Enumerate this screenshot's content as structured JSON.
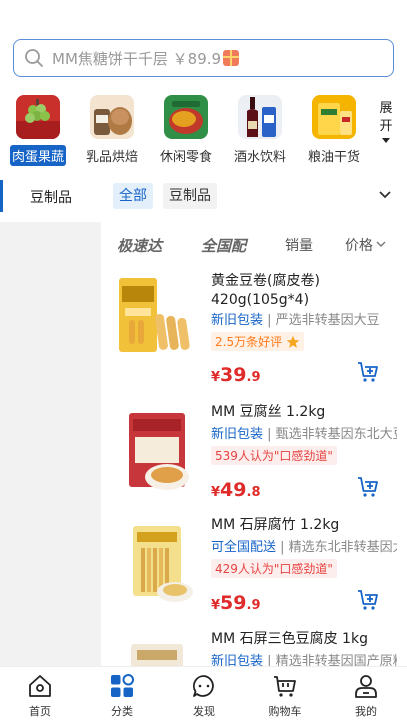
{
  "search": {
    "placeholder": "MM焦糖饼干千层 ￥89.9"
  },
  "categories": [
    {
      "label": "肉蛋果蔬",
      "active": true
    },
    {
      "label": "乳品烘焙",
      "active": false
    },
    {
      "label": "休闲零食",
      "active": false
    },
    {
      "label": "酒水饮料",
      "active": false
    },
    {
      "label": "粮油干货",
      "active": false
    }
  ],
  "expand": {
    "line1": "展",
    "line2": "开"
  },
  "subbar": {
    "title": "豆制品",
    "chips": [
      {
        "label": "全部",
        "active": true
      },
      {
        "label": "豆制品",
        "active": false
      }
    ]
  },
  "sort": {
    "express": "极速达",
    "nationwide": "全国配",
    "sales": "销量",
    "price": "价格"
  },
  "products": [
    {
      "name": "黄金豆卷(腐皮卷) 420g(105g*4)",
      "tag": "新旧包装",
      "desc": "严选非转基因大豆",
      "badge": "2.5万条好评",
      "badge_style": "orange",
      "price_currency": "¥",
      "price_int": "39",
      "price_dec": ".9"
    },
    {
      "name": "MM 豆腐丝 1.2kg",
      "tag": "新旧包装",
      "desc": "甄选非转基因东北大豆",
      "badge": "539人认为\"口感劲道\"",
      "badge_style": "red",
      "price_currency": "¥",
      "price_int": "49",
      "price_dec": ".8"
    },
    {
      "name": "MM 石屏腐竹 1.2kg",
      "tag": "可全国配送",
      "desc": "精选东北非转基因大豆",
      "badge": "429人认为\"口感劲道\"",
      "badge_style": "red",
      "price_currency": "¥",
      "price_int": "59",
      "price_dec": ".9"
    },
    {
      "name": "MM 石屏三色豆腐皮 1kg",
      "tag": "新旧包装",
      "desc": "精选非转基因国产原料",
      "badge": "",
      "badge_style": "red",
      "price_currency": "",
      "price_int": "",
      "price_dec": ""
    }
  ],
  "tabs": [
    {
      "label": "首页",
      "icon": "home-icon",
      "active": false
    },
    {
      "label": "分类",
      "icon": "category-icon",
      "active": true
    },
    {
      "label": "发现",
      "icon": "discover-icon",
      "active": false
    },
    {
      "label": "购物车",
      "icon": "cart-icon",
      "active": false
    },
    {
      "label": "我的",
      "icon": "profile-icon",
      "active": false
    }
  ],
  "colors": {
    "accent": "#1764c7",
    "price": "#e02b2b",
    "badge_red": "#e64340",
    "badge_orange": "#ff7a1a"
  }
}
